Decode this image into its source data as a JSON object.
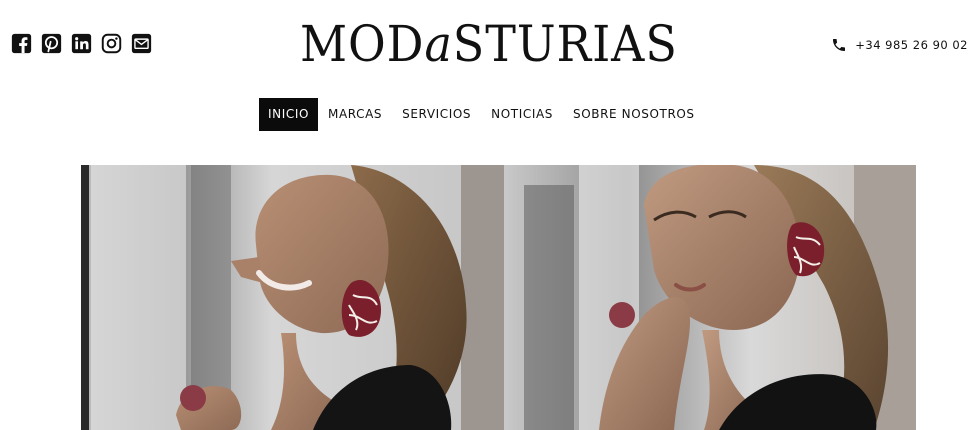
{
  "social": {
    "icons": [
      "facebook-icon",
      "pinterest-icon",
      "linkedin-icon",
      "instagram-icon",
      "email-icon"
    ]
  },
  "brand": {
    "logo_part1": "MOD",
    "logo_part2": "a",
    "logo_part3": "STURIAS"
  },
  "contact": {
    "phone_icon": "phone-icon",
    "phone": "+34 985 26 90 02"
  },
  "nav": {
    "items": [
      "INICIO",
      "MARCAS",
      "SERVICIOS",
      "NOTICIAS",
      "SOBRE NOSOTROS"
    ],
    "active": "INICIO"
  },
  "colors": {
    "nav_active_bg": "#0b0b0b",
    "text": "#111111",
    "earring": "#7a1f2b"
  }
}
